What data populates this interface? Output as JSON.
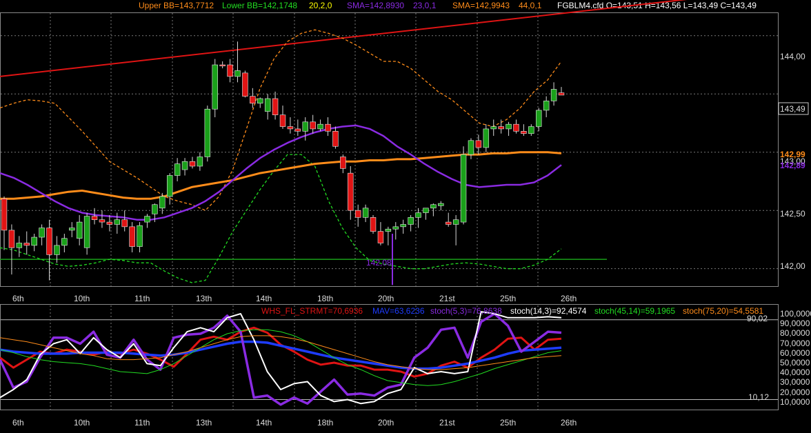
{
  "header": {
    "bb_upper": "Upper BB=143,7712",
    "bb_lower": "Lower BB=142,1748",
    "bb_params": "20,2,0",
    "sma1": "SMA=142,8930",
    "sma1_params": "23,0,1",
    "sma2": "SMA=142,9943",
    "sma2_params": "44,0,1",
    "ohlc": "FGBLM4.cfd O=143,51 H=143,56 L=143,49 C=143,49"
  },
  "colors": {
    "background": "#000000",
    "bb_upper": "#ff8c1a",
    "bb_lower": "#22dd22",
    "sma_purple": "#8a2be2",
    "sma_orange": "#ff8c1a",
    "candle_up": "#1aa01a",
    "candle_down": "#e01414",
    "trendline": "#e01414",
    "support_line": "#1aa01a",
    "grid": "#7a7a7a"
  },
  "price_axis": {
    "labels": [
      "144,00",
      "143,49",
      "143,00",
      "142,50",
      "142,00"
    ],
    "last_price": "143,49",
    "sma_orange_label": "142,99",
    "sma_purple_label": "142,89"
  },
  "marker_label": "142,08",
  "lower_header": {
    "whs": "WHS_FL_STRMT=70,6936",
    "mav": "MAV=63,6236",
    "stoch1": "stoch(5,3)=76,8638",
    "stoch2": "stoch(14,3)=92,4574",
    "stoch3": "stoch(45,14)=59,1965",
    "stoch4": "stoch(75,20)=54,5581"
  },
  "lower_axis": {
    "labels": [
      "100,0000",
      "90,0000",
      "80,0000",
      "70,0000",
      "60,0000",
      "50,0000",
      "40,0000",
      "30,0000",
      "20,0000",
      "10,0000"
    ],
    "level_high": "90,02",
    "level_low": "10,12"
  },
  "x_axis": {
    "labels": [
      "6th",
      "10th",
      "11th",
      "13th",
      "14th",
      "18th",
      "20th",
      "21st",
      "25th",
      "26th"
    ]
  },
  "chart_data": {
    "type": "candlestick",
    "price_ylim": [
      141.85,
      144.2
    ],
    "grid": true,
    "candles_ohlc": [
      [
        142.6,
        142.62,
        142.16,
        142.33
      ],
      [
        142.33,
        142.38,
        141.95,
        142.18
      ],
      [
        142.18,
        142.28,
        142.1,
        142.22
      ],
      [
        142.22,
        142.32,
        142.12,
        142.2
      ],
      [
        142.2,
        142.3,
        142.15,
        142.27
      ],
      [
        142.27,
        142.38,
        142.2,
        142.35
      ],
      [
        142.35,
        142.42,
        141.9,
        142.12
      ],
      [
        142.12,
        142.28,
        142.05,
        142.2
      ],
      [
        142.2,
        142.3,
        142.14,
        142.26
      ],
      [
        142.33,
        142.4,
        142.27,
        142.35
      ],
      [
        142.26,
        142.46,
        142.2,
        142.4
      ],
      [
        142.18,
        142.48,
        142.12,
        142.45
      ],
      [
        142.45,
        142.52,
        142.38,
        142.42
      ],
      [
        142.42,
        142.5,
        142.35,
        142.4
      ],
      [
        142.4,
        142.46,
        142.32,
        142.38
      ],
      [
        142.38,
        142.48,
        142.3,
        142.42
      ],
      [
        142.42,
        142.5,
        142.32,
        142.36
      ],
      [
        142.36,
        142.4,
        142.14,
        142.19
      ],
      [
        142.19,
        142.4,
        142.14,
        142.37
      ],
      [
        142.4,
        142.47,
        142.35,
        142.45
      ],
      [
        142.47,
        142.56,
        142.4,
        142.55
      ],
      [
        142.52,
        142.65,
        142.47,
        142.62
      ],
      [
        142.62,
        142.82,
        142.55,
        142.8
      ],
      [
        142.8,
        142.95,
        142.75,
        142.9
      ],
      [
        142.85,
        142.95,
        142.8,
        142.92
      ],
      [
        142.92,
        142.96,
        142.86,
        142.88
      ],
      [
        142.88,
        143.0,
        142.84,
        142.96
      ],
      [
        142.96,
        143.4,
        142.92,
        143.37
      ],
      [
        143.37,
        143.8,
        143.3,
        143.75
      ],
      [
        143.75,
        143.78,
        143.72,
        143.74
      ],
      [
        143.75,
        143.8,
        143.6,
        143.65
      ],
      [
        143.65,
        143.95,
        143.6,
        143.7
      ],
      [
        143.68,
        143.7,
        143.47,
        143.48
      ],
      [
        143.48,
        143.55,
        143.38,
        143.42
      ],
      [
        143.42,
        143.47,
        143.38,
        143.46
      ],
      [
        143.35,
        143.5,
        143.28,
        143.46
      ],
      [
        143.46,
        143.52,
        143.28,
        143.32
      ],
      [
        143.32,
        143.4,
        143.2,
        143.22
      ],
      [
        143.22,
        143.3,
        143.16,
        143.2
      ],
      [
        143.2,
        143.28,
        143.14,
        143.18
      ],
      [
        143.18,
        143.3,
        143.1,
        143.26
      ],
      [
        143.26,
        143.32,
        143.16,
        143.2
      ],
      [
        143.2,
        143.28,
        143.18,
        143.24
      ],
      [
        143.24,
        143.3,
        143.14,
        143.18
      ],
      [
        143.18,
        143.22,
        143.03,
        143.05
      ],
      [
        142.96,
        142.98,
        142.82,
        142.86
      ],
      [
        142.82,
        142.88,
        142.42,
        142.5
      ],
      [
        142.5,
        142.55,
        142.36,
        142.44
      ],
      [
        142.44,
        142.55,
        142.4,
        142.52
      ],
      [
        142.44,
        142.46,
        142.3,
        142.32
      ],
      [
        142.32,
        142.4,
        142.2,
        142.22
      ],
      [
        142.32,
        142.36,
        142.2,
        142.34
      ],
      [
        142.34,
        142.4,
        142.25,
        142.36
      ],
      [
        142.36,
        142.42,
        142.3,
        142.38
      ],
      [
        142.38,
        142.46,
        142.32,
        142.44
      ],
      [
        142.44,
        142.52,
        142.35,
        142.48
      ],
      [
        142.48,
        142.52,
        142.42,
        142.52
      ],
      [
        142.52,
        142.56,
        142.45,
        142.55
      ],
      [
        142.54,
        142.58,
        142.5,
        142.56
      ],
      [
        142.4,
        142.48,
        142.36,
        142.38
      ],
      [
        142.38,
        142.46,
        142.2,
        142.42
      ],
      [
        142.4,
        143.05,
        142.38,
        142.98
      ],
      [
        142.98,
        143.12,
        142.94,
        143.1
      ],
      [
        143.1,
        143.15,
        142.98,
        143.04
      ],
      [
        143.04,
        143.24,
        143.0,
        143.2
      ],
      [
        143.2,
        143.28,
        143.14,
        143.22
      ],
      [
        143.22,
        143.28,
        143.16,
        143.2
      ],
      [
        143.2,
        143.26,
        143.14,
        143.24
      ],
      [
        143.24,
        143.28,
        143.16,
        143.18
      ],
      [
        143.18,
        143.24,
        143.14,
        143.16
      ],
      [
        143.16,
        143.24,
        143.14,
        143.22
      ],
      [
        143.22,
        143.38,
        143.18,
        143.36
      ],
      [
        143.36,
        143.48,
        143.3,
        143.44
      ],
      [
        143.44,
        143.6,
        143.4,
        143.54
      ],
      [
        143.51,
        143.56,
        143.49,
        143.49
      ]
    ],
    "bb_upper": [
      143.38,
      143.42,
      143.45,
      143.44,
      143.42,
      143.3,
      143.18,
      143.05,
      142.92,
      142.85,
      142.78,
      142.7,
      142.62,
      142.58,
      142.55,
      142.5,
      142.62,
      142.85,
      143.2,
      143.55,
      143.8,
      143.95,
      144.02,
      144.05,
      144.02,
      143.98,
      143.92,
      143.85,
      143.78,
      143.78,
      143.72,
      143.62,
      143.52,
      143.45,
      143.35,
      143.25,
      143.22,
      143.28,
      143.38,
      143.52,
      143.62,
      143.78
    ],
    "bb_lower": [
      142.18,
      142.16,
      142.12,
      142.08,
      142.04,
      142.02,
      142.03,
      142.05,
      142.08,
      142.07,
      142.05,
      142.05,
      141.98,
      141.92,
      141.88,
      141.9,
      142.1,
      142.32,
      142.5,
      142.68,
      142.84,
      142.98,
      142.98,
      142.88,
      142.58,
      142.35,
      142.18,
      142.07,
      142.04,
      142.02,
      142.0,
      142.0,
      142.02,
      142.04,
      142.05,
      142.04,
      142.02,
      142.0,
      142.0,
      142.03,
      142.08,
      142.17
    ],
    "sma_purple": [
      142.82,
      142.78,
      142.72,
      142.65,
      142.58,
      142.52,
      142.48,
      142.46,
      142.45,
      142.44,
      142.42,
      142.42,
      142.44,
      142.48,
      142.52,
      142.58,
      142.66,
      142.76,
      142.86,
      142.95,
      143.02,
      143.08,
      143.13,
      143.17,
      143.2,
      143.22,
      143.23,
      143.2,
      143.14,
      143.05,
      142.98,
      142.9,
      142.83,
      142.77,
      142.72,
      142.7,
      142.71,
      142.72,
      142.72,
      142.74,
      142.8,
      142.89
    ],
    "sma_orange": [
      142.6,
      142.6,
      142.61,
      142.62,
      142.64,
      142.66,
      142.67,
      142.65,
      142.63,
      142.61,
      142.6,
      142.6,
      142.62,
      142.66,
      142.7,
      142.72,
      142.74,
      142.76,
      142.79,
      142.82,
      142.84,
      142.86,
      142.88,
      142.9,
      142.91,
      142.92,
      142.92,
      142.93,
      142.93,
      142.94,
      142.94,
      142.95,
      142.96,
      142.97,
      142.98,
      142.98,
      142.99,
      142.99,
      143.0,
      143.0,
      143.0,
      142.99
    ],
    "trendline": [
      [
        143.65,
        0
      ],
      [
        144.4,
        1
      ]
    ],
    "support_level": 142.08,
    "lower_ylim": [
      0,
      105
    ],
    "lower_series": [
      {
        "name": "WHS_FL_STRMT",
        "color": "#e01414",
        "values": [
          52,
          42,
          50,
          58,
          56,
          60,
          58,
          55,
          58,
          56,
          60,
          56,
          50,
          43,
          56,
          70,
          73,
          70,
          78,
          82,
          77,
          65,
          58,
          50,
          45,
          47,
          44,
          44,
          40,
          40,
          38,
          33,
          36,
          44,
          48,
          42,
          52,
          60,
          71,
          72,
          60,
          70,
          71
        ]
      },
      {
        "name": "MAV",
        "color": "#1e3cff",
        "values": [
          60,
          58,
          57,
          56,
          56,
          56,
          57,
          57,
          57,
          57,
          56,
          55,
          54,
          55,
          57,
          60,
          63,
          66,
          68,
          68,
          67,
          64,
          61,
          58,
          55,
          52,
          50,
          48,
          46,
          44,
          42,
          41,
          41,
          42,
          44,
          46,
          49,
          52,
          56,
          59,
          60,
          61,
          62
        ]
      },
      {
        "name": "stoch(5,3)",
        "color": "#8a2be2",
        "values": [
          50,
          22,
          28,
          52,
          72,
          72,
          66,
          78,
          55,
          52,
          70,
          50,
          40,
          72,
          75,
          76,
          82,
          94,
          78,
          12,
          14,
          5,
          12,
          6,
          18,
          30,
          15,
          16,
          14,
          22,
          25,
          52,
          62,
          80,
          82,
          52,
          88,
          96,
          84,
          58,
          68,
          78,
          77
        ]
      },
      {
        "name": "stoch(14,3)",
        "color": "#ffffff",
        "values": [
          12,
          20,
          30,
          55,
          66,
          70,
          56,
          72,
          60,
          52,
          66,
          46,
          44,
          62,
          78,
          82,
          78,
          92,
          96,
          70,
          38,
          20,
          26,
          28,
          14,
          8,
          10,
          6,
          8,
          16,
          20,
          42,
          36,
          38,
          36,
          38,
          98,
          96,
          92,
          92,
          92,
          93,
          92
        ]
      },
      {
        "name": "stoch(45,14)",
        "color": "#22dd22",
        "values": [
          60,
          57,
          53,
          50,
          48,
          47,
          46,
          44,
          41,
          38,
          37,
          36,
          40,
          46,
          54,
          62,
          70,
          76,
          79,
          80,
          80,
          78,
          74,
          68,
          60,
          52,
          45,
          40,
          34,
          29,
          27,
          25,
          24,
          25,
          28,
          32,
          36,
          41,
          45,
          49,
          53,
          57,
          59
        ]
      },
      {
        "name": "stoch(75,20)",
        "color": "#ff8c1a",
        "values": [
          72,
          70,
          68,
          65,
          62,
          59,
          56,
          54,
          51,
          50,
          50,
          51,
          52,
          55,
          58,
          62,
          66,
          70,
          73,
          74,
          74,
          73,
          71,
          68,
          64,
          60,
          56,
          52,
          48,
          45,
          43,
          41,
          40,
          40,
          41,
          42,
          44,
          46,
          48,
          50,
          52,
          53,
          54
        ]
      }
    ]
  }
}
